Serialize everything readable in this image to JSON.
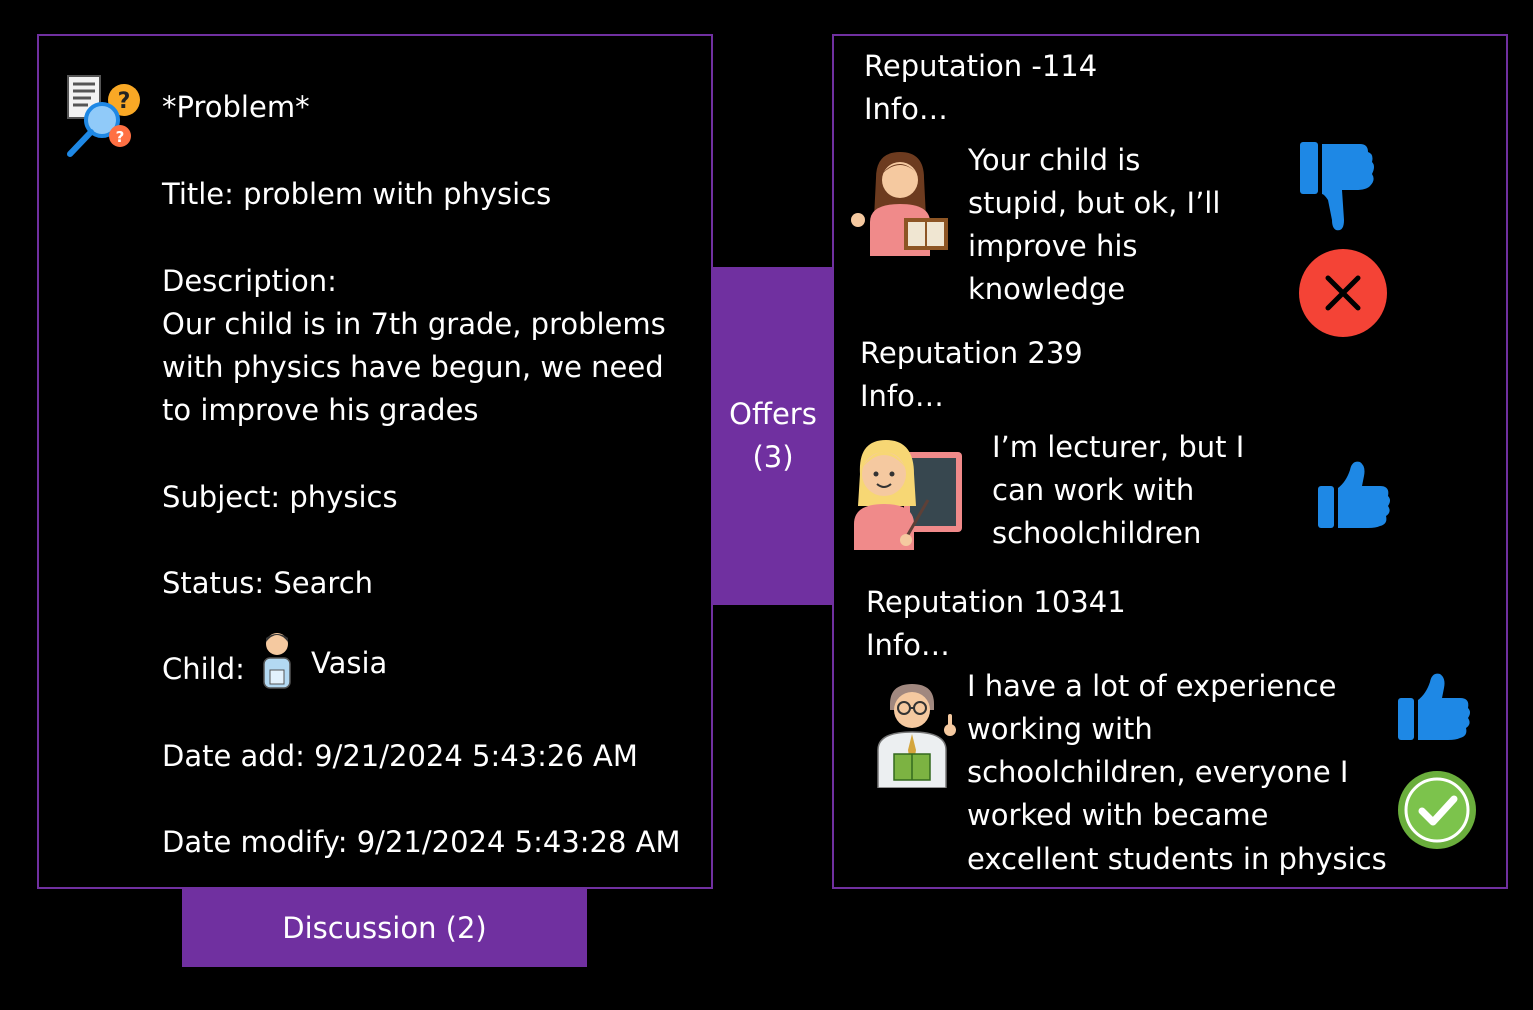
{
  "problem": {
    "header": "*Problem*",
    "title_line": "Title: problem with physics",
    "description_label": "Description:",
    "description_lines": [
      "Our child is in 7th grade, problems",
      "with physics have begun, we need",
      "to improve his grades"
    ],
    "subject_line": "Subject: physics",
    "status_line": "Status: Search",
    "child_label": "Child:",
    "child_name": "Vasia",
    "date_add_line": "Date add: 9/21/2024 5:43:26 AM",
    "date_modify_line": "Date modify: 9/21/2024 5:43:28 AM"
  },
  "tabs": {
    "offers_line1": "Offers",
    "offers_line2": "(3)",
    "discussion": "Discussion (2)"
  },
  "offers": [
    {
      "reputation": "Reputation -114",
      "info": "Info…",
      "message_lines": [
        "Your child is",
        "stupid, but ok, I’ll",
        "improve his",
        "knowledge"
      ],
      "icons": [
        "thumbs-down-icon",
        "reject-icon"
      ]
    },
    {
      "reputation": "Reputation 239",
      "info": "Info…",
      "message_lines": [
        "I’m lecturer, but I",
        "can work with",
        "schoolchildren"
      ],
      "icons": [
        "thumbs-up-icon"
      ]
    },
    {
      "reputation": "Reputation 10341",
      "info": "Info…",
      "message_lines": [
        "I have a lot of experience",
        "working with",
        "schoolchildren, everyone I",
        "worked with became",
        "excellent students in physics"
      ],
      "icons": [
        "thumbs-up-icon",
        "accept-icon"
      ]
    }
  ],
  "colors": {
    "accent": "#7030a0",
    "thumb": "#1e88e5",
    "reject": "#f44336",
    "accept": "#6aae3c"
  }
}
